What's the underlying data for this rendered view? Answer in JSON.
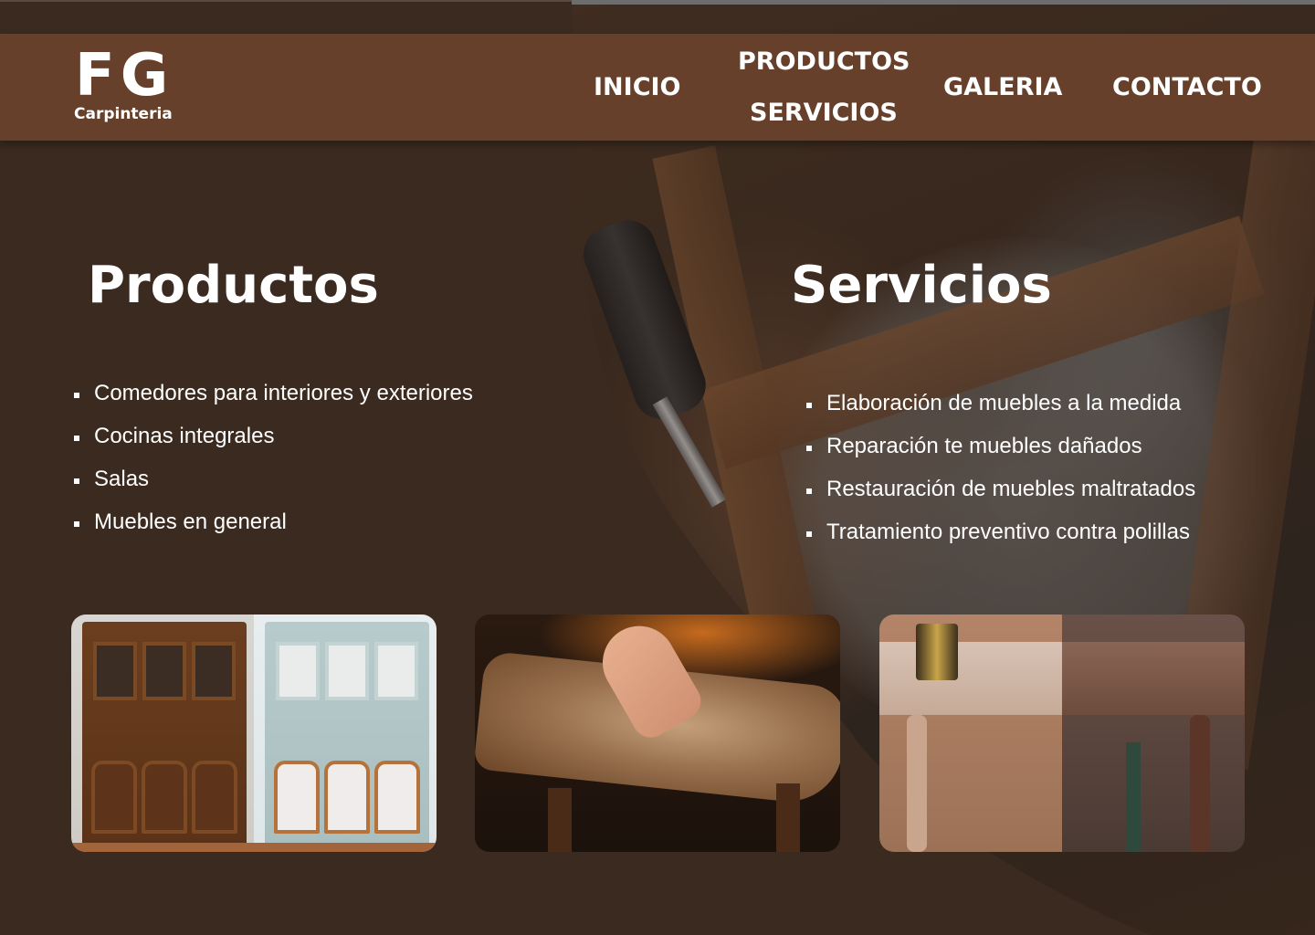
{
  "brand": {
    "mark": "FG",
    "subtitle": "Carpinteria"
  },
  "nav": {
    "inicio": "INICIO",
    "productos": "PRODUCTOS",
    "servicios": "SERVICIOS",
    "galeria": "GALERIA",
    "contacto": "CONTACTO"
  },
  "productos": {
    "title": "Productos",
    "items": [
      "Comedores para interiores y exteriores",
      "Cocinas integrales",
      "Salas",
      "Muebles en general"
    ]
  },
  "servicios": {
    "title": "Servicios",
    "items": [
      "Elaboración de muebles a la medida",
      "Reparación te muebles dañados",
      "Restauración de muebles maltratados",
      "Tratamiento preventivo contra polillas"
    ]
  },
  "colors": {
    "background": "#3b2a1f",
    "header": "#66402b",
    "text": "#ffffff"
  }
}
